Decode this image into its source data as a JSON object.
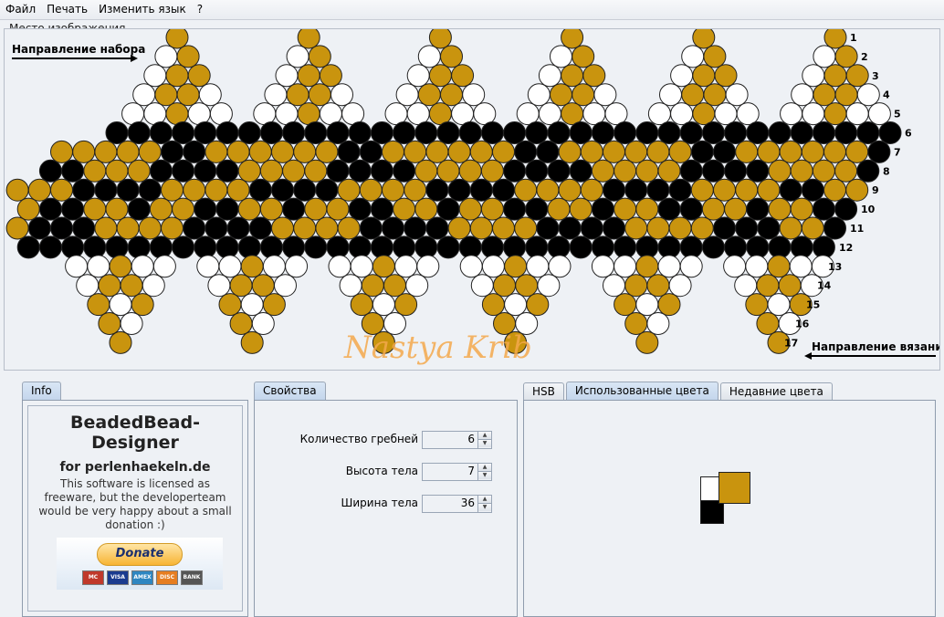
{
  "menu": {
    "items": [
      "Файл",
      "Печать",
      "Изменить язык",
      "?"
    ]
  },
  "canvas": {
    "title": "Место изображения",
    "direction_set": "Направление набора",
    "direction_knit": "Направление вязания",
    "watermark": "Nastya Krib",
    "row_numbers": [
      "1",
      "2",
      "3",
      "4",
      "5",
      "6",
      "7",
      "8",
      "9",
      "10",
      "11",
      "12",
      "13",
      "14",
      "15",
      "16",
      "17"
    ]
  },
  "colors": {
    "gold": "#c9940e",
    "black": "#000000",
    "white": "#ffffff",
    "outline": "#222222"
  },
  "info": {
    "tab": "Info",
    "app_title": "BeadedBead-Designer",
    "subtitle": "for perlenhaekeln.de",
    "license": "This software is licensed as freeware, but the developerteam would be very happy about a small donation :)",
    "donate": "Donate",
    "cards": [
      "MC",
      "VISA",
      "AMEX",
      "DISC",
      "BANK"
    ]
  },
  "props": {
    "tab": "Свойства",
    "fields": [
      {
        "label": "Количество гребней",
        "value": "6"
      },
      {
        "label": "Высота тела",
        "value": "7"
      },
      {
        "label": "Ширина тела",
        "value": "36"
      }
    ]
  },
  "color_tabs": {
    "hsb": "HSB",
    "used": "Использованные цвета",
    "recent": "Недавние цвета"
  },
  "pattern": {
    "body": [
      "KKKKKKKKKKKKKKKKKKKKKKKKKKKKKKKKKKKK",
      "GGGGGKKGGGGGGKKGGGGGGKKGGGGGGKKGGGGGGK",
      "KKGGGKKKKGGGGKKKKGGGGKKKKGGGGKKKKGGGGK",
      "GGGKKKKGGGGKKKKGGGGKKKKGGGGKKKKGGGGKKGG",
      "GGKKGGKGGKKGGKGGKKGGKGGKKGGKGGKKGGKGGKK",
      "GGGGKKKGGGGKKKKGGGGKKKKGGGGKKKKGGGGKKKGGK",
      "KKKKKKKKKKKKKKKKKKKKKKKKKKKKKKKKKKKKKKKKKKK"
    ]
  }
}
